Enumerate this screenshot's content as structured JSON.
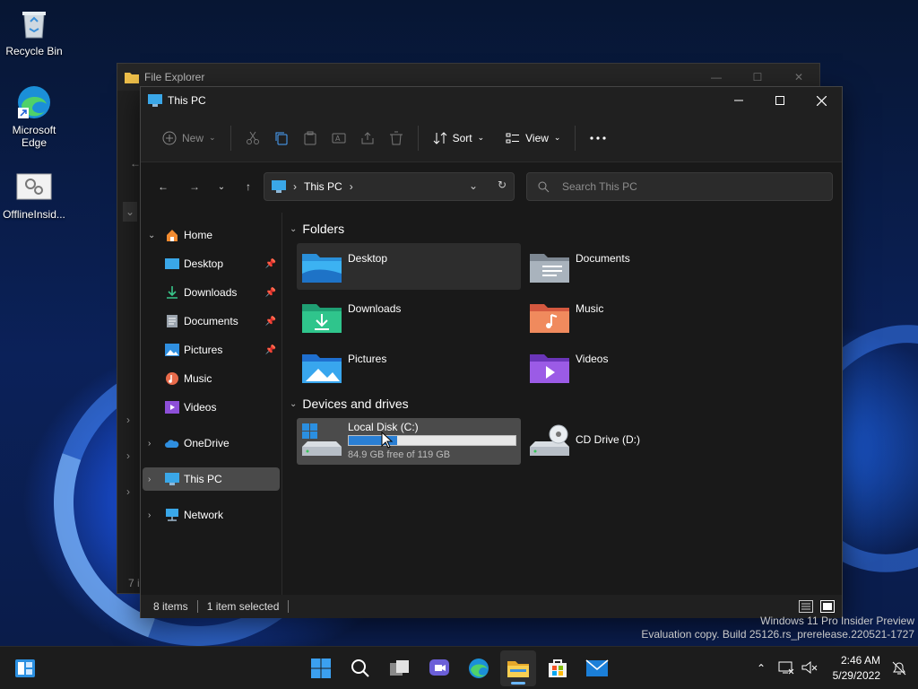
{
  "desktop": {
    "icons": [
      {
        "label": "Recycle Bin"
      },
      {
        "label": "Microsoft Edge"
      },
      {
        "label": "OfflineInsid..."
      }
    ]
  },
  "background_window": {
    "title": "File Explorer",
    "status_fragment": "7 i"
  },
  "window": {
    "title": "This PC",
    "ribbon": {
      "new_label": "New",
      "sort_label": "Sort",
      "view_label": "View"
    },
    "address": {
      "crumb": "This PC"
    },
    "search": {
      "placeholder": "Search This PC"
    },
    "nav": {
      "home": "Home",
      "quick_access": [
        "Desktop",
        "Downloads",
        "Documents",
        "Pictures",
        "Music",
        "Videos"
      ],
      "onedrive": "OneDrive",
      "this_pc": "This PC",
      "network": "Network"
    },
    "sections": {
      "folders_title": "Folders",
      "devices_title": "Devices and drives"
    },
    "folders": [
      {
        "name": "Desktop"
      },
      {
        "name": "Documents"
      },
      {
        "name": "Downloads"
      },
      {
        "name": "Music"
      },
      {
        "name": "Pictures"
      },
      {
        "name": "Videos"
      }
    ],
    "drives": [
      {
        "name": "Local Disk (C:)",
        "free_text": "84.9 GB free of 119 GB",
        "used_fraction": 0.29
      },
      {
        "name": "CD Drive (D:)"
      }
    ],
    "status": {
      "items": "8 items",
      "selected": "1 item selected"
    }
  },
  "watermark": {
    "line1": "Windows 11 Pro Insider Preview",
    "line2": "Evaluation copy. Build 25126.rs_prerelease.220521-1727"
  },
  "taskbar": {
    "time": "2:46 AM",
    "date": "5/29/2022"
  },
  "colors": {
    "accent": "#2a7fd4",
    "window_bg": "#191919",
    "selection": "#4b4b4b"
  }
}
